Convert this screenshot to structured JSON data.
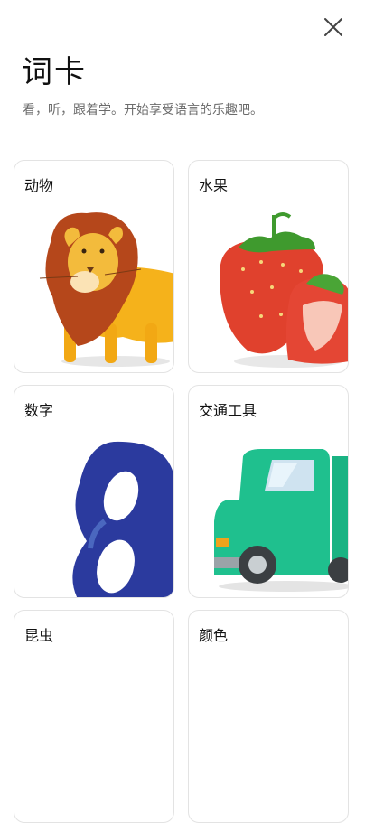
{
  "header": {
    "title": "词卡",
    "subtitle": "看，听，跟着学。开始享受语言的乐趣吧。",
    "close_icon": "close-icon"
  },
  "cards": [
    {
      "label": "动物",
      "art": "lion-illustration"
    },
    {
      "label": "水果",
      "art": "strawberry-illustration"
    },
    {
      "label": "数字",
      "art": "number-eight-illustration"
    },
    {
      "label": "交通工具",
      "art": "truck-illustration"
    },
    {
      "label": "昆虫",
      "art": ""
    },
    {
      "label": "颜色",
      "art": ""
    }
  ],
  "colors": {
    "card_border": "#e3e3e3",
    "lion_mane": "#b5471b",
    "lion_body": "#f5b21b",
    "strawberry": "#e0412d",
    "leaf": "#3f9a2e",
    "eight": "#2b3a9e",
    "truck": "#1fc08e"
  }
}
